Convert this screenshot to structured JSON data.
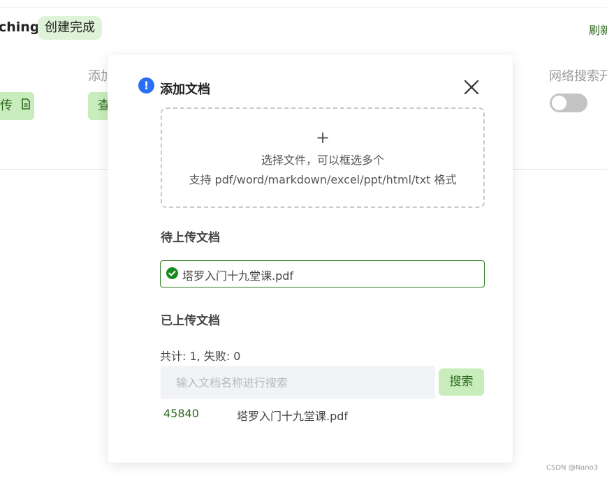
{
  "background": {
    "title": "ching",
    "status_badge": "创建完成",
    "refresh_link": "刷新",
    "add_label": "添加",
    "upload_button_label": "传",
    "view_button_label": "查",
    "web_search_label": "网络搜索开",
    "web_search_enabled": false
  },
  "dialog": {
    "title": "添加文档",
    "info_icon": "exclamation-circle-icon",
    "close_icon": "close-icon",
    "dropzone": {
      "plus": "+",
      "line1": "选择文件，可以框选多个",
      "line2": "支持 pdf/word/markdown/excel/ppt/html/txt 格式"
    },
    "pending": {
      "title": "待上传文档",
      "files": [
        {
          "name": "塔罗入门十九堂课.pdf",
          "status": "ready"
        }
      ]
    },
    "uploaded": {
      "title": "已上传文档",
      "stats": "共计: 1, 失败: 0",
      "search_placeholder": "输入文档名称进行搜索",
      "search_value": "",
      "search_button": "搜索",
      "rows": [
        {
          "id": "45840",
          "name": "塔罗入门十九堂课.pdf"
        }
      ]
    }
  },
  "watermark": "CSDN @Nano3",
  "colors": {
    "accent_green": "#2e6b1f",
    "button_bg": "#c9ecbc",
    "info_blue": "#2a6df6",
    "success_green": "#188a1a"
  }
}
